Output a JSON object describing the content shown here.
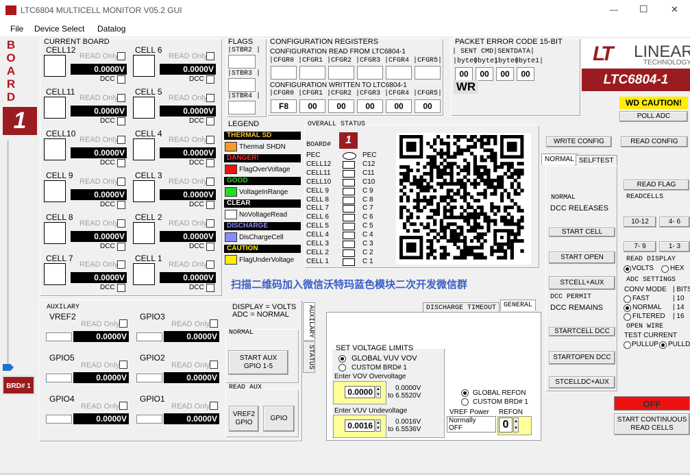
{
  "window": {
    "title": "LTC6804 MULTICELL MONITOR V05.2 GUI",
    "minimize": "—",
    "maximize": "☐",
    "close": "✕"
  },
  "menu": [
    "File",
    "Device Select",
    "Datalog"
  ],
  "board_letters": [
    "B",
    "O",
    "A",
    "R",
    "D"
  ],
  "board_number": "1",
  "brd_button": "BRD# 1",
  "current_board": {
    "title": "CURRENT BOARD",
    "cells_left": [
      {
        "name": "CELL12",
        "value": "0.0000V"
      },
      {
        "name": "CELL11",
        "value": "0.0000V"
      },
      {
        "name": "CELL10",
        "value": "0.0000V"
      },
      {
        "name": "CELL 9",
        "value": "0.0000V"
      },
      {
        "name": "CELL 8",
        "value": "0.0000V"
      },
      {
        "name": "CELL 7",
        "value": "0.0000V"
      }
    ],
    "cells_right": [
      {
        "name": "CELL 6",
        "value": "0.0000V"
      },
      {
        "name": "CELL 5",
        "value": "0.0000V"
      },
      {
        "name": "CELL 4",
        "value": "0.0000V"
      },
      {
        "name": "CELL 3",
        "value": "0.0000V"
      },
      {
        "name": "CELL 2",
        "value": "0.0000V"
      },
      {
        "name": "CELL 1",
        "value": "0.0000V"
      }
    ],
    "read_only": "READ Only",
    "dcc": "DCC"
  },
  "flags": {
    "title": "FLAGS",
    "items": [
      "|STBR2 |",
      "|STBR3 |",
      "|STBR4 |"
    ]
  },
  "config": {
    "title": "CONFIGURATION REGISTERS",
    "read_title": "CONFIGURATION READ FROM LTC6804-1",
    "read_headers": [
      "|CFGR0",
      "|CFGR1",
      "|CFGR2",
      "|CFGR3",
      "|CFGR4",
      "|CFGR5|"
    ],
    "write_title": "CONFIGURATION WRITTEN TO LTC6804-1",
    "write_headers": [
      "|CFGR0",
      "|CFGR1",
      "|CFGR2",
      "|CFGR3",
      "|CFGR4",
      "|CFGR5|"
    ],
    "write_values": [
      "F8",
      "00",
      "00",
      "00",
      "00",
      "00"
    ]
  },
  "pec": {
    "title": "PACKET ERROR CODE 15-BIT",
    "sent_cmd": "| SENT CMD",
    "sent_data": "|SENTDATA|",
    "bytes": [
      "|byte0",
      "|byte1",
      "|byte0",
      "|byte1|"
    ],
    "values": [
      "00",
      "00",
      "00",
      "00"
    ],
    "wr": "WR"
  },
  "logo": {
    "brand": "LINEAR",
    "sub": "TECHNOLOGY",
    "part": "LTC6804-1"
  },
  "wd_caution": "WD CAUTION!",
  "buttons": {
    "poll_adc": "POLL ADC",
    "write_config": "WRITE CONFIG",
    "read_config": "READ CONFIG",
    "read_flag": "READ FLAG",
    "start_cell": "START CELL",
    "start_open": "START OPEN",
    "stcell_aux": "STCELL+AUX",
    "startcell_dcc": "STARTCELL DCC",
    "startopen_dcc": "STARTOPEN DCC",
    "stcelldc_aux": "STCELLDC+AUX",
    "r10_12": "10-12",
    "r4_6": "4- 6",
    "r7_9": "7- 9",
    "r1_3": "1- 3",
    "off": "OFF",
    "start_cont": "START CONTINUOUS\nREAD CELLS",
    "start_aux": "START AUX\nGPIO 1-5",
    "vref2_gpio": "VREF2\nGPIO",
    "gpio": "GPIO"
  },
  "tabs": {
    "normal": "NORMAL",
    "selftest": "SELFTEST",
    "discharge_timeout": "DISCHARGE TIMEOUT",
    "general": "GENERAL",
    "auxilary": "AUXILARY",
    "status": "STATUS"
  },
  "right": {
    "normal_label": "NORMAL",
    "dcc_releases": "DCC RELEASES",
    "dcc_permit": "DCC PERMIT",
    "dcc_remains": "DCC REMAINS",
    "readcells": "READCELLS",
    "read_display": "READ DISPLAY",
    "volts": "VOLTS",
    "hex": "HEX",
    "adc_settings": "ADC SETTINGS",
    "conv_mode": "CONV MODE",
    "bits": "| BITS",
    "fast": "FAST",
    "normal": "NORMAL",
    "filtered": "FILTERED",
    "bits_vals": [
      "| 10",
      "| 14",
      "| 16"
    ],
    "open_wire": "OPEN WIRE",
    "test_current": "TEST CURRENT",
    "pullup": "PULLUP",
    "pulldn": "PULLDN"
  },
  "legend": {
    "title": "LEGEND",
    "items": [
      {
        "bar": "THERMAL SD",
        "bar_color": "#f4c242",
        "swatch": "#f79b2e",
        "label": "Thermal SHDN"
      },
      {
        "bar": "DANGER!",
        "bar_color": "#ff2a2a",
        "swatch": "#ee1111",
        "label": "FlagOverVoltage"
      },
      {
        "bar": "GOOD",
        "bar_color": "#22dd22",
        "swatch": "#22dd22",
        "label": "VoltageInRange"
      },
      {
        "bar": "CLEAR",
        "bar_color": "#ffffff",
        "swatch": "#ffffff",
        "label": "NoVoltageRead"
      },
      {
        "bar": "DISCHARGE",
        "bar_color": "#8888ff",
        "swatch": "#8a8aff",
        "label": "DisChargeCell"
      },
      {
        "bar": "CAUTION",
        "bar_color": "#ffee00",
        "swatch": "#ffee00",
        "label": "FlagUnderVoltage"
      }
    ]
  },
  "overall": {
    "title": "OVERALL STATUS",
    "board_label": "BOARD#",
    "board_num": "1",
    "left": [
      "PEC",
      "CELL12",
      "CELL11",
      "CELL10",
      "CELL 9",
      "CELL 8",
      "CELL 7",
      "CELL 6",
      "CELL 5",
      "CELL 4",
      "CELL 3",
      "CELL 2",
      "CELL 1"
    ],
    "right": [
      "PEC",
      "C12",
      "C11",
      "C10",
      "C 9",
      "C 8",
      "C 7",
      "C 6",
      "C 5",
      "C 4",
      "C 3",
      "C 2",
      "C 1"
    ]
  },
  "banner": "扫描二维码加入微信沃特玛蓝色模块二次开发微信群",
  "aux": {
    "title": "AUXILARY",
    "display": "DISPLAY = VOLTS",
    "adc": "ADC = NORMAL",
    "normal": "NORMAL",
    "read_aux": "READ AUX",
    "channels": [
      {
        "name": "VREF2",
        "value": "0.0000V"
      },
      {
        "name": "GPIO3",
        "value": "0.0000V"
      },
      {
        "name": "GPIO5",
        "value": "0.0000V"
      },
      {
        "name": "GPIO2",
        "value": "0.0000V"
      },
      {
        "name": "GPIO4",
        "value": "0.0000V"
      },
      {
        "name": "GPIO1",
        "value": "0.0000V"
      }
    ]
  },
  "limits": {
    "title": "SET VOLTAGE LIMITS",
    "global": "GLOBAL VUV VOV",
    "custom": "CUSTOM BRD# 1",
    "vov_label": "Enter VOV Overvoltage",
    "vov_value": "0.0000",
    "vov_range1": "0.0000V",
    "vov_range2": "to 6.5520V",
    "vuv_label": "Enter VUV Undevoltage",
    "vuv_value": "0.0016",
    "vuv_range1": "0.0016V",
    "vuv_range2": "to 6.5536V",
    "global_refon": "GLOBAL REFON",
    "custom_refon": "CUSTOM BRD# 1",
    "vref_power": "VREF Power",
    "vref_val1": "Normally",
    "vref_val2": "OFF",
    "refon": "REFON",
    "refon_val": "0"
  }
}
